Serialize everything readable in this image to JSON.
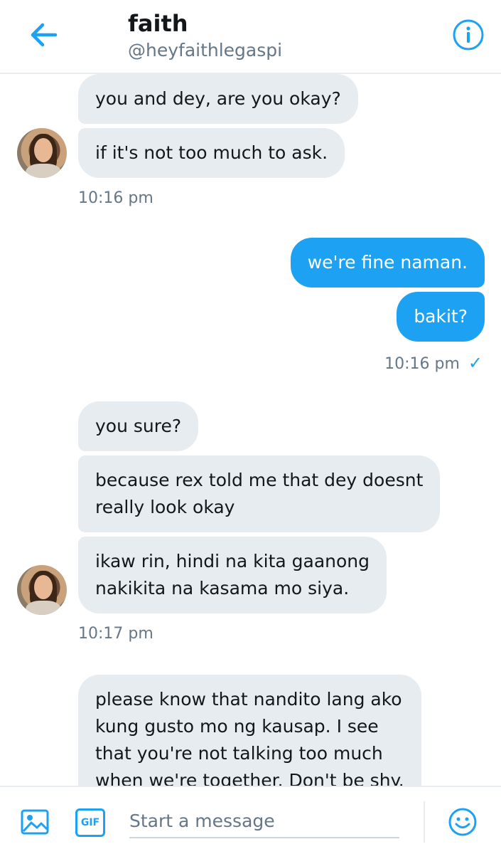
{
  "header": {
    "name": "faith",
    "handle": "@heyfaithlegaspi"
  },
  "messages": {
    "m1": "you and dey, are you okay?",
    "m2": "if it's not too much to ask.",
    "t1": "10:16 pm",
    "m3": "we're fine naman.",
    "m4": "bakit?",
    "t2": "10:16 pm",
    "m5": "you sure?",
    "m6": "because rex told me that dey doesnt\nreally look okay",
    "m7": "ikaw rin, hindi na kita gaanong\nnakikita na kasama mo siya.",
    "t3": "10:17 pm",
    "m8": "please know that nandito lang ako\nkung gusto mo ng kausap. I see\nthat you're not talking too much\nwhen we're together. Don't be shy."
  },
  "composer": {
    "placeholder": "Start a message",
    "gif_label": "GIF"
  },
  "icons": {
    "back": "arrow-left-icon",
    "info": "info-icon",
    "media": "image-icon",
    "gif": "gif-icon",
    "emoji": "smiley-icon",
    "read": "checkmark-icon"
  },
  "colors": {
    "accent": "#1da1f2",
    "incoming_bubble": "#e6ecf0",
    "secondary_text": "#657786"
  }
}
